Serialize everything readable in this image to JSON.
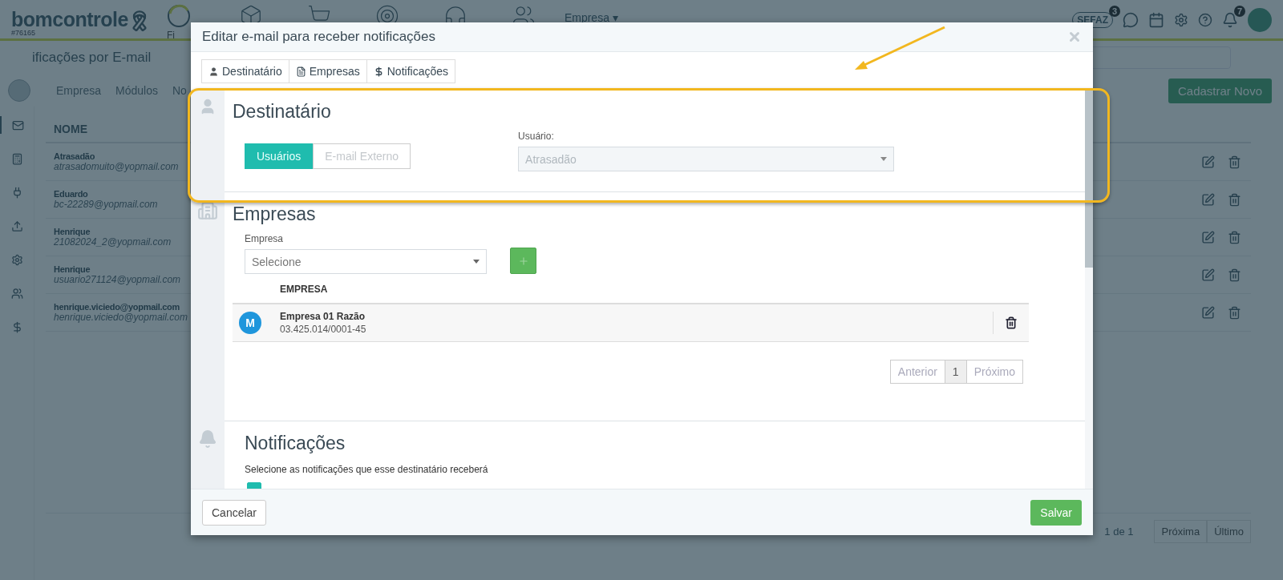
{
  "app": {
    "logo": "bomcontrole",
    "account": "#76165",
    "nav_label": "Fi",
    "nav_menu": "Empresa",
    "nav_caret": "▾",
    "sefaz": "SEFAZ",
    "sefaz_count": "3",
    "bell_count": "7"
  },
  "page": {
    "title": "ificações por E-mail",
    "filters": [
      "Empresa",
      "Módulos",
      "No"
    ],
    "new_button": "Cadastrar Novo",
    "column": "NOME",
    "rows": [
      {
        "name": "Atrasadão",
        "email": "atrasadomuito@yopmail.com"
      },
      {
        "name": "Eduardo",
        "email": "bc-22289@yopmail.com"
      },
      {
        "name": "Henrique",
        "email": "21082024_2@yopmail.com"
      },
      {
        "name": "Henrique",
        "email": "usuario271124@yopmail.com"
      },
      {
        "name": "henrique.viciedo@yopmail.com",
        "email": "henrique.viciedo@yopmail.com"
      }
    ],
    "pagination": {
      "info": "1 de 1",
      "buttons": [
        "Próxima",
        "Último"
      ]
    }
  },
  "modal": {
    "title": "Editar e-mail para receber notificações",
    "tabs": [
      {
        "label": "Destinatário"
      },
      {
        "label": "Empresas"
      },
      {
        "label": "Notificações"
      }
    ],
    "recipient": {
      "title": "Destinatário",
      "options": [
        {
          "label": "Usuários",
          "selected": true
        },
        {
          "label": "E-mail Externo",
          "selected": false
        }
      ],
      "user_label": "Usuário:",
      "user_value": "Atrasadão",
      "disabled": true
    },
    "companies": {
      "title": "Empresas",
      "field_label": "Empresa",
      "prompt": "Selecione",
      "column": "EMPRESA",
      "rows": [
        {
          "initial": "M",
          "name": "Empresa 01 Razão",
          "cnpj": "03.425.014/0001-45"
        }
      ],
      "pagination": [
        {
          "label": "Anterior",
          "selected": false
        },
        {
          "label": "1",
          "selected": true
        },
        {
          "label": "Próximo",
          "selected": false
        }
      ]
    },
    "notifications": {
      "title": "Notificações",
      "subtitle": "Selecione as notificações que esse destinatário receberá",
      "options": [
        {
          "checked": true
        }
      ]
    },
    "cancel": "Cancelar",
    "save": "Salvar"
  }
}
